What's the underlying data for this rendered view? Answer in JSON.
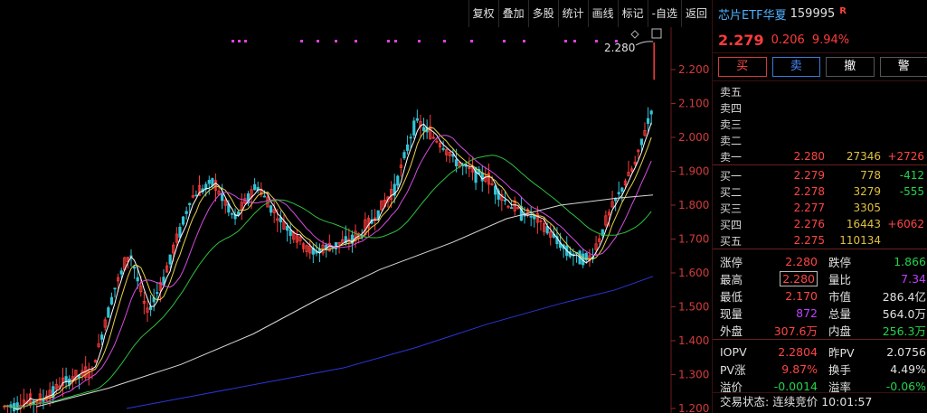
{
  "toolbar": {
    "items": [
      "复权",
      "叠加",
      "多股",
      "统计",
      "画线",
      "标记",
      "-自选",
      "返回"
    ]
  },
  "chart": {
    "price_labels": [
      "2.200",
      "2.100",
      "2.000",
      "1.900",
      "1.800",
      "1.700",
      "1.600",
      "1.500",
      "1.400",
      "1.300",
      "1.200"
    ],
    "high_marker": "2.280",
    "colors": {
      "up": "#ff3b3b",
      "down": "#33c3d6",
      "ma5": "#ffffff",
      "ma10": "#e8d24a",
      "ma20": "#d44de0",
      "ma60": "#2fbf3f",
      "ma120": "#d8d8d8",
      "ma250": "#2a36d8"
    }
  },
  "chart_data": {
    "type": "candlestick",
    "y_axis_ticks": [
      2.2,
      2.1,
      2.0,
      1.9,
      1.8,
      1.7,
      1.6,
      1.5,
      1.4,
      1.3,
      1.2
    ],
    "ylim": [
      1.2,
      2.2
    ],
    "last_high_label": "2.280"
  },
  "quote": {
    "name": "芯片ETF华夏",
    "code": "159995",
    "badge": "R",
    "last": "2.279",
    "change": "0.206",
    "pct": "9.94%"
  },
  "trade": {
    "buy": "买",
    "sell": "卖",
    "cancel": "撤",
    "alert": "警"
  },
  "asks": [
    {
      "label": "卖五",
      "price": "",
      "vol": "",
      "delta": ""
    },
    {
      "label": "卖四",
      "price": "",
      "vol": "",
      "delta": ""
    },
    {
      "label": "卖三",
      "price": "",
      "vol": "",
      "delta": ""
    },
    {
      "label": "卖二",
      "price": "",
      "vol": "",
      "delta": ""
    },
    {
      "label": "卖一",
      "price": "2.280",
      "vol": "27346",
      "delta": "+2726"
    }
  ],
  "bids": [
    {
      "label": "买一",
      "price": "2.279",
      "vol": "778",
      "delta": "-412"
    },
    {
      "label": "买二",
      "price": "2.278",
      "vol": "3279",
      "delta": "-555"
    },
    {
      "label": "买三",
      "price": "2.277",
      "vol": "3305",
      "delta": ""
    },
    {
      "label": "买四",
      "price": "2.276",
      "vol": "16443",
      "delta": "+6062"
    },
    {
      "label": "买五",
      "price": "2.275",
      "vol": "110134",
      "delta": ""
    }
  ],
  "stats": [
    {
      "k": "涨停",
      "v": "2.280",
      "c": "red",
      "k2": "跌停",
      "v2": "1.866",
      "c2": "grn"
    },
    {
      "k": "最高",
      "v": "2.280",
      "c": "red",
      "boxed": true,
      "k2": "量比",
      "v2": "7.34",
      "c2": "mag"
    },
    {
      "k": "最低",
      "v": "2.170",
      "c": "red",
      "k2": "市值",
      "v2": "286.4亿",
      "c2": "wht"
    },
    {
      "k": "现量",
      "v": "872",
      "c": "mag",
      "k2": "总量",
      "v2": "564.0万",
      "c2": "wht"
    },
    {
      "k": "外盘",
      "v": "307.6万",
      "c": "red",
      "k2": "内盘",
      "v2": "256.3万",
      "c2": "grn"
    }
  ],
  "stats2": [
    {
      "k": "IOPV",
      "v": "2.2804",
      "c": "red",
      "k2": "昨PV",
      "v2": "2.0756",
      "c2": "wht"
    },
    {
      "k": "PV涨",
      "v": "9.87%",
      "c": "red",
      "k2": "换手",
      "v2": "4.49%",
      "c2": "wht"
    },
    {
      "k": "溢价",
      "v": "-0.0014",
      "c": "grn",
      "k2": "溢率",
      "v2": "-0.06%",
      "c2": "grn"
    }
  ],
  "status": {
    "label": "交易状态:",
    "state": "连续竞价",
    "time": "10:01:57"
  }
}
